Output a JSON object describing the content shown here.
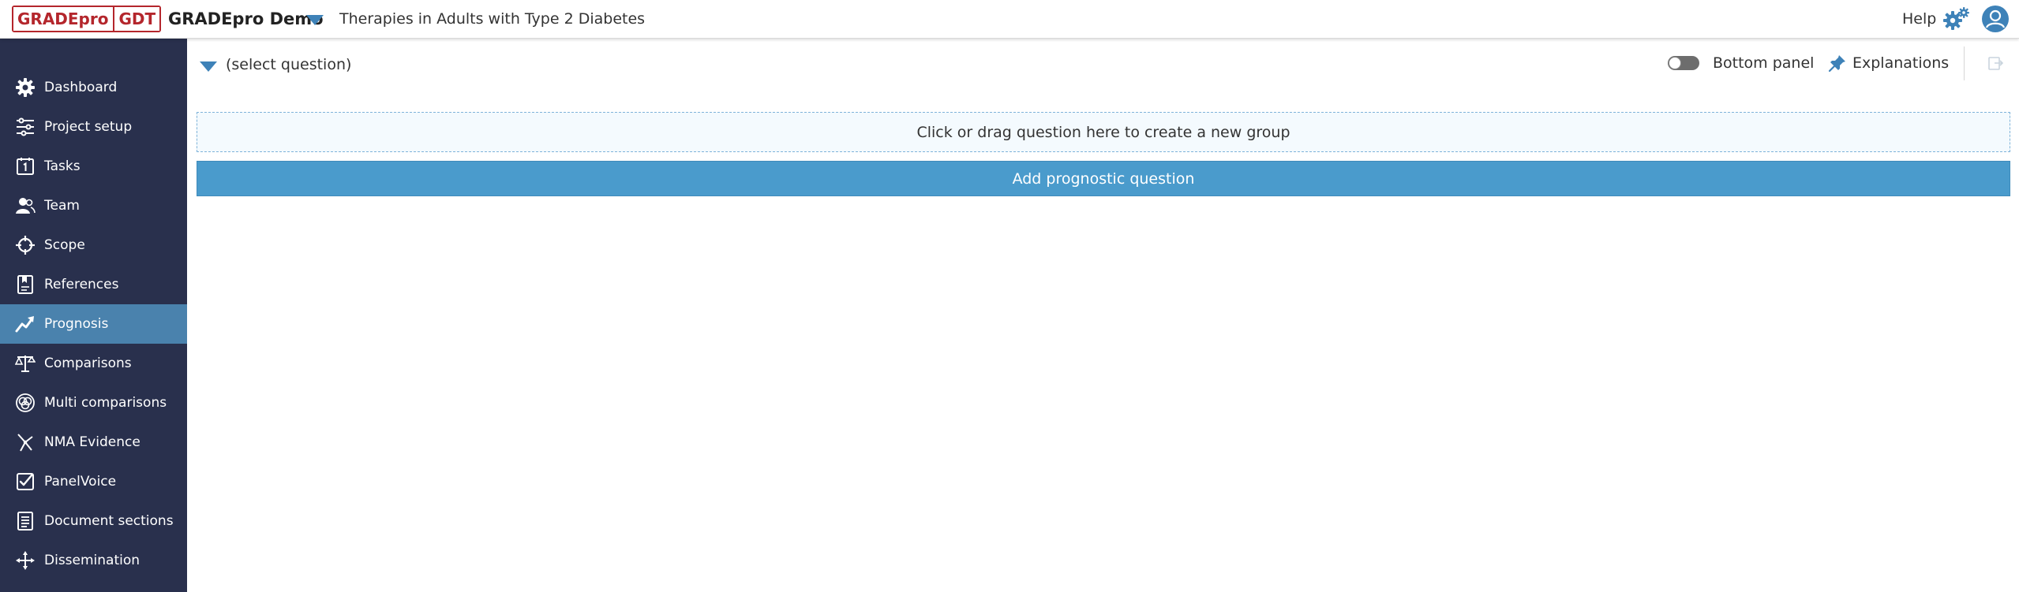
{
  "header": {
    "logo_left": "GRADEpro",
    "logo_right": "GDT",
    "project_name": "GRADEpro Demo",
    "question_title": "Therapies in Adults with Type 2 Diabetes",
    "help_label": "Help",
    "icons": [
      "settings-gears-icon",
      "user-avatar-icon",
      "dropdown-caret-icon"
    ]
  },
  "sidebar": {
    "items": [
      {
        "label": "Dashboard",
        "icon": "gear-icon",
        "active": false
      },
      {
        "label": "Project setup",
        "icon": "sliders-icon",
        "active": false
      },
      {
        "label": "Tasks",
        "icon": "calendar-icon",
        "active": false
      },
      {
        "label": "Team",
        "icon": "team-icon",
        "active": false
      },
      {
        "label": "Scope",
        "icon": "crosshair-icon",
        "active": false
      },
      {
        "label": "References",
        "icon": "references-icon",
        "active": false
      },
      {
        "label": "Prognosis",
        "icon": "trend-icon",
        "active": true
      },
      {
        "label": "Comparisons",
        "icon": "scales-icon",
        "active": false
      },
      {
        "label": "Multi comparisons",
        "icon": "multi-circles-icon",
        "active": false
      },
      {
        "label": "NMA Evidence",
        "icon": "network-icon",
        "active": false
      },
      {
        "label": "PanelVoice",
        "icon": "checkbox-icon",
        "active": false
      },
      {
        "label": "Document sections",
        "icon": "document-icon",
        "active": false
      },
      {
        "label": "Dissemination",
        "icon": "share-arrows-icon",
        "active": false
      }
    ]
  },
  "main": {
    "select_question_label": "(select question)",
    "bottom_panel_label": "Bottom panel",
    "bottom_panel_enabled": false,
    "explanations_label": "Explanations",
    "drop_zone_text": "Click or drag question here to create a new group",
    "add_button_label": "Add prognostic question"
  },
  "colors": {
    "sidebar_bg": "#29304d",
    "sidebar_active": "#4a82ad",
    "accent": "#3e82b8",
    "button_bg": "#4a9bcc",
    "logo_red": "#b4262c"
  }
}
